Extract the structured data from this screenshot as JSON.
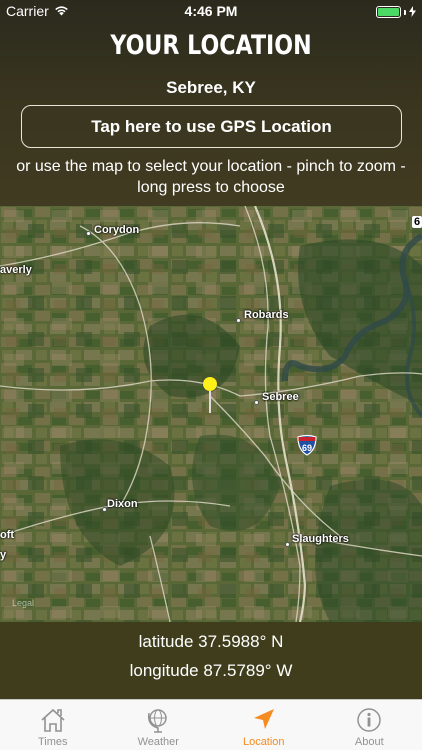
{
  "status_bar": {
    "carrier": "Carrier",
    "time": "4:46 PM"
  },
  "header": {
    "title": "YOUR LOCATION",
    "place": "Sebree, KY",
    "gps_button_label": "Tap here to use GPS Location",
    "instructions": "or use the map to select your location - pinch to zoom - long press to choose"
  },
  "map": {
    "labels": {
      "corydon": "Corydon",
      "waverly": "averly",
      "robards": "Robards",
      "sebree": "Sebree",
      "dixon": "Dixon",
      "slaughters": "Slaughters",
      "left_edge_top": "oft",
      "left_edge_bottom": "y",
      "legal": "Legal",
      "interstate": "69",
      "edge_badge": "6"
    }
  },
  "coordinates": {
    "latitude": "latitude 37.5988° N",
    "longitude": "longitude 87.5789° W"
  },
  "tabs": [
    {
      "label": "Times",
      "icon": "house-icon"
    },
    {
      "label": "Weather",
      "icon": "globe-icon"
    },
    {
      "label": "Location",
      "icon": "location-arrow-icon",
      "active": true
    },
    {
      "label": "About",
      "icon": "info-icon"
    }
  ],
  "colors": {
    "accent": "#f68b1f",
    "pin": "#ffef19",
    "battery": "#4cd964",
    "coords_panel": "#3f3d1c"
  }
}
